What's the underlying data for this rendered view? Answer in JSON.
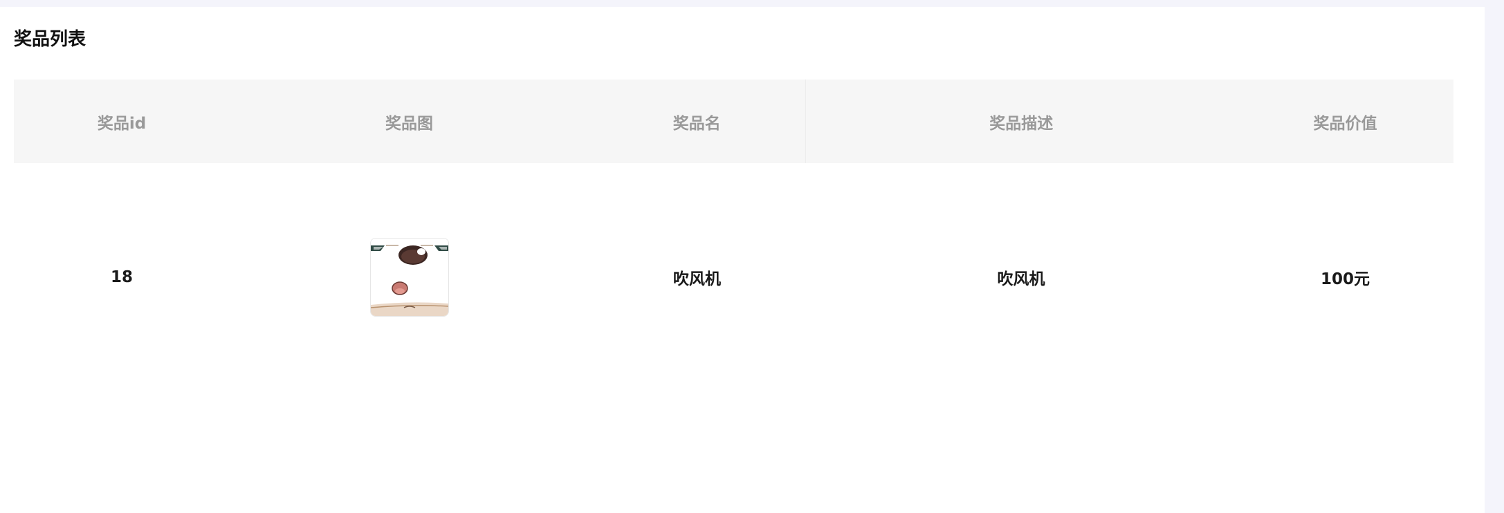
{
  "card": {
    "title": "奖品列表"
  },
  "table": {
    "columns": [
      "奖品id",
      "奖品图",
      "奖品名",
      "奖品描述",
      "奖品价值"
    ],
    "rows": [
      {
        "id": "18",
        "image_icon": "prize-thumbnail-image",
        "name": "吹风机",
        "description": "吹风机",
        "value": "100元"
      }
    ]
  },
  "colors": {
    "page_background": "#f4f4fb",
    "panel_background": "#ffffff",
    "header_background": "#f6f6f6",
    "header_text": "#999999",
    "body_text": "#1a1a1a"
  }
}
